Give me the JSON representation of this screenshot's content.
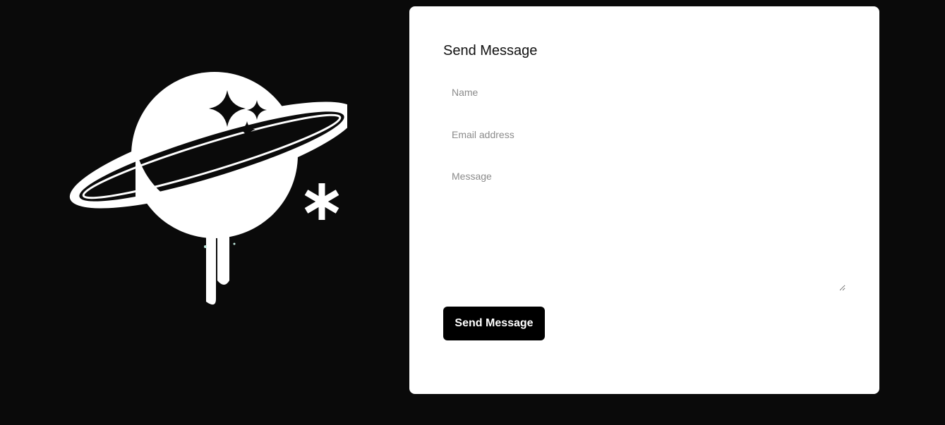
{
  "logo": {
    "icon": "planet-logo-icon",
    "accent_color": "#ffffff"
  },
  "form": {
    "title": "Send Message",
    "name_placeholder": "Name",
    "email_placeholder": "Email address",
    "message_placeholder": "Message",
    "submit_label": "Send Message"
  },
  "colors": {
    "background": "#0a0a0a",
    "card": "#ffffff",
    "button": "#000000"
  }
}
